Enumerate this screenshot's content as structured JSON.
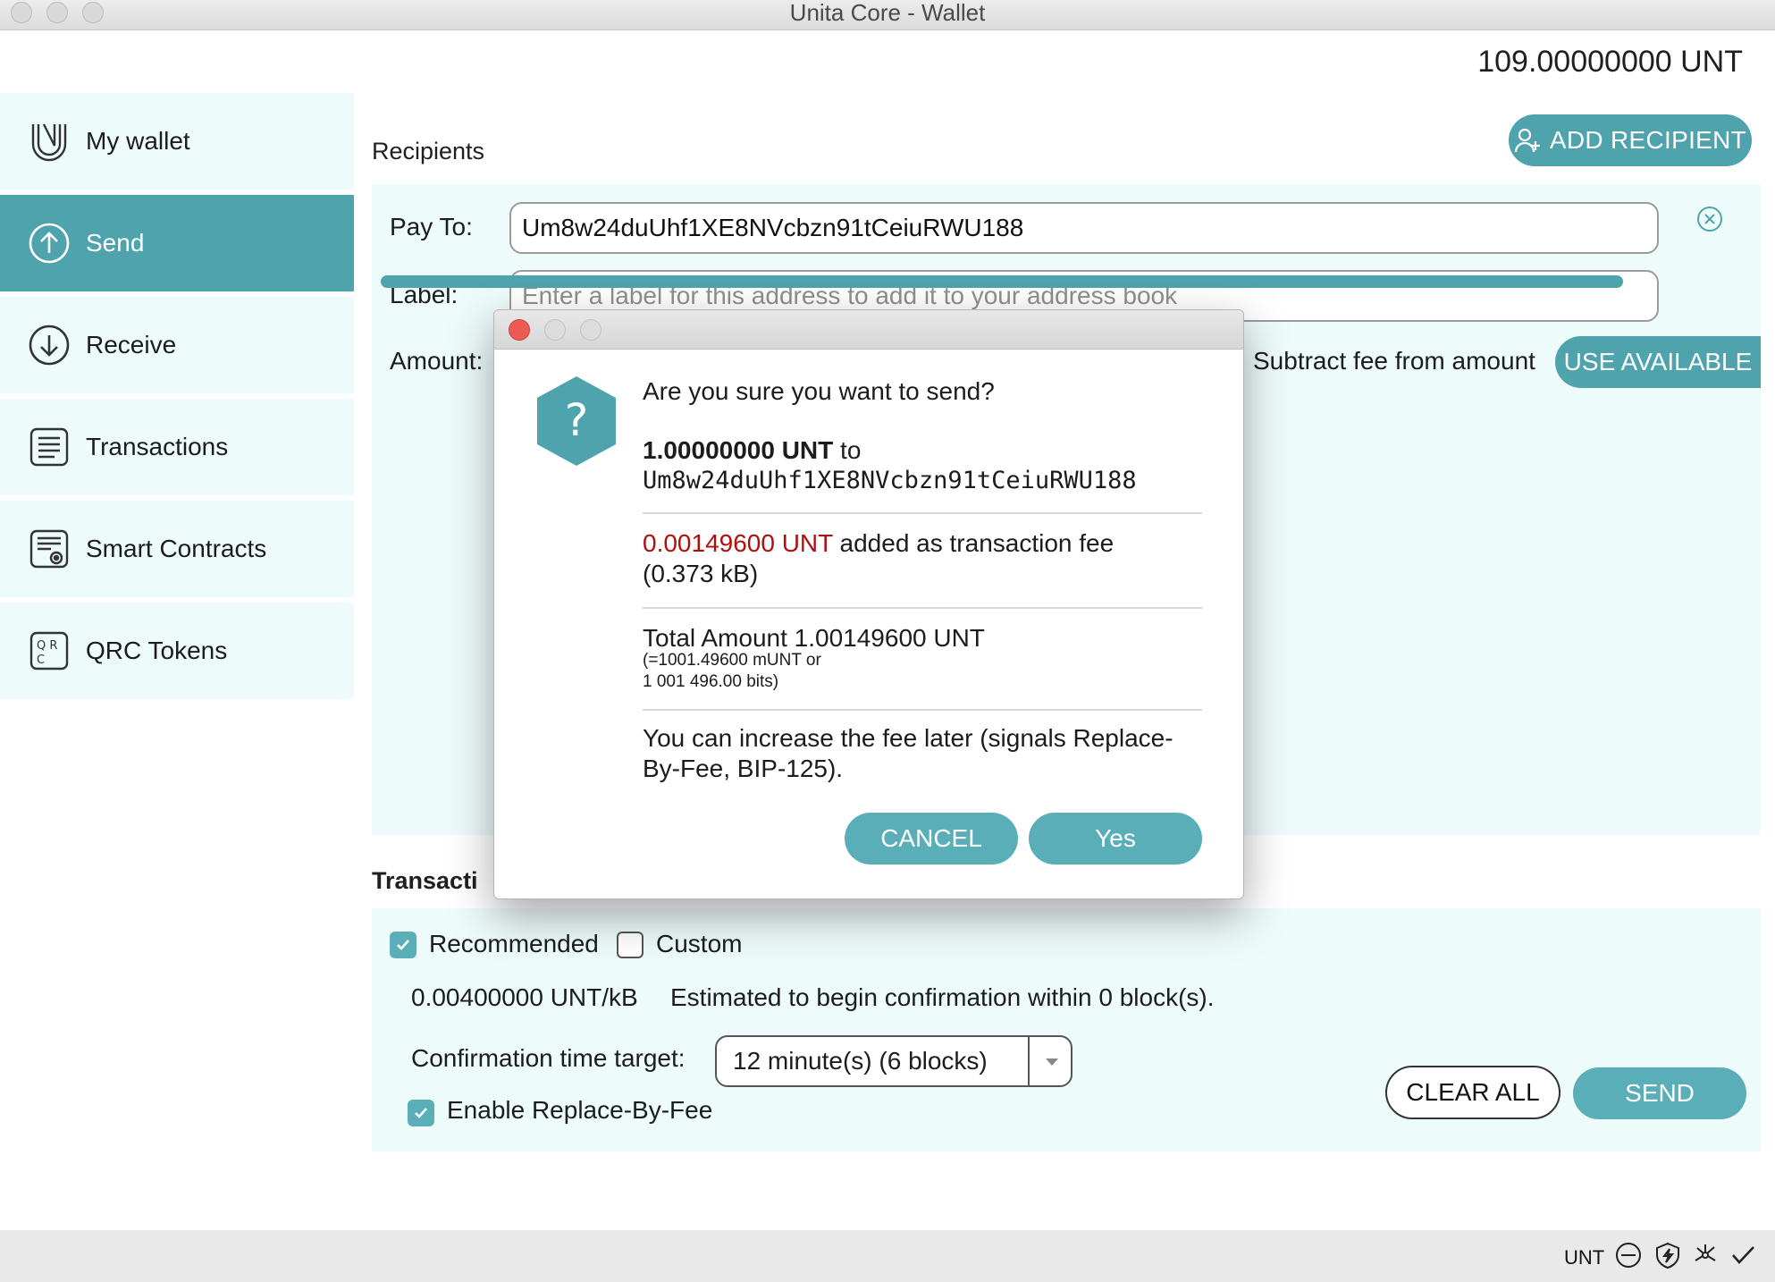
{
  "window": {
    "title": "Unita Core - Wallet"
  },
  "balance": "109.00000000 UNT",
  "sidebar": {
    "items": [
      {
        "label": "My wallet",
        "icon": "wallet-icon"
      },
      {
        "label": "Send",
        "icon": "send-arrow-icon",
        "active": true
      },
      {
        "label": "Receive",
        "icon": "receive-arrow-icon"
      },
      {
        "label": "Transactions",
        "icon": "transactions-list-icon"
      },
      {
        "label": "Smart Contracts",
        "icon": "smart-contracts-icon"
      },
      {
        "label": "QRC Tokens",
        "icon": "qrc-tokens-icon"
      }
    ]
  },
  "recipients": {
    "title": "Recipients",
    "add_recipient_label": "ADD RECIPIENT",
    "pay_to_label": "Pay To:",
    "pay_to_value": "Um8w24duUhf1XE8NVcbzn91tCeiuRWU188",
    "label_label": "Label:",
    "label_placeholder": "Enter a label for this address to add it to your address book",
    "amount_label": "Amount:",
    "subtract_fee_label": "Subtract fee from amount",
    "use_available_label": "USE AVAILABLE"
  },
  "fee": {
    "section_title": "Transacti",
    "recommended_label": "Recommended",
    "recommended_checked": true,
    "custom_label": "Custom",
    "custom_checked": false,
    "rate": "0.00400000 UNT/kB",
    "estimate": "Estimated to begin confirmation within 0 block(s).",
    "confirmation_target_label": "Confirmation time target:",
    "confirmation_target_value": "12 minute(s) (6 blocks)",
    "rbf_label": "Enable Replace-By-Fee",
    "rbf_checked": true
  },
  "actions": {
    "clear_all": "CLEAR ALL",
    "send": "SEND"
  },
  "statusbar": {
    "unit": "UNT"
  },
  "dialog": {
    "question": "Are you sure you want to send?",
    "amount": "1.00000000 UNT",
    "to_word": "to",
    "address": "Um8w24duUhf1XE8NVcbzn91tCeiuRWU188",
    "fee_amount": "0.00149600 UNT",
    "fee_text": "added as transaction fee",
    "fee_size": "(0.373 kB)",
    "total_line": "Total Amount 1.00149600 UNT",
    "total_sub1": "(=1001.49600 mUNT or",
    "total_sub2": "1 001 496.00 bits)",
    "rbf_line1": "You can increase the fee later (signals Replace-",
    "rbf_line2": "By-Fee, BIP-125).",
    "cancel_label": "CANCEL",
    "yes_label": "Yes"
  },
  "colors": {
    "accent": "#4fa3ad",
    "sidebar_bg": "#eefbfb",
    "fee_red": "#b00f0f"
  }
}
